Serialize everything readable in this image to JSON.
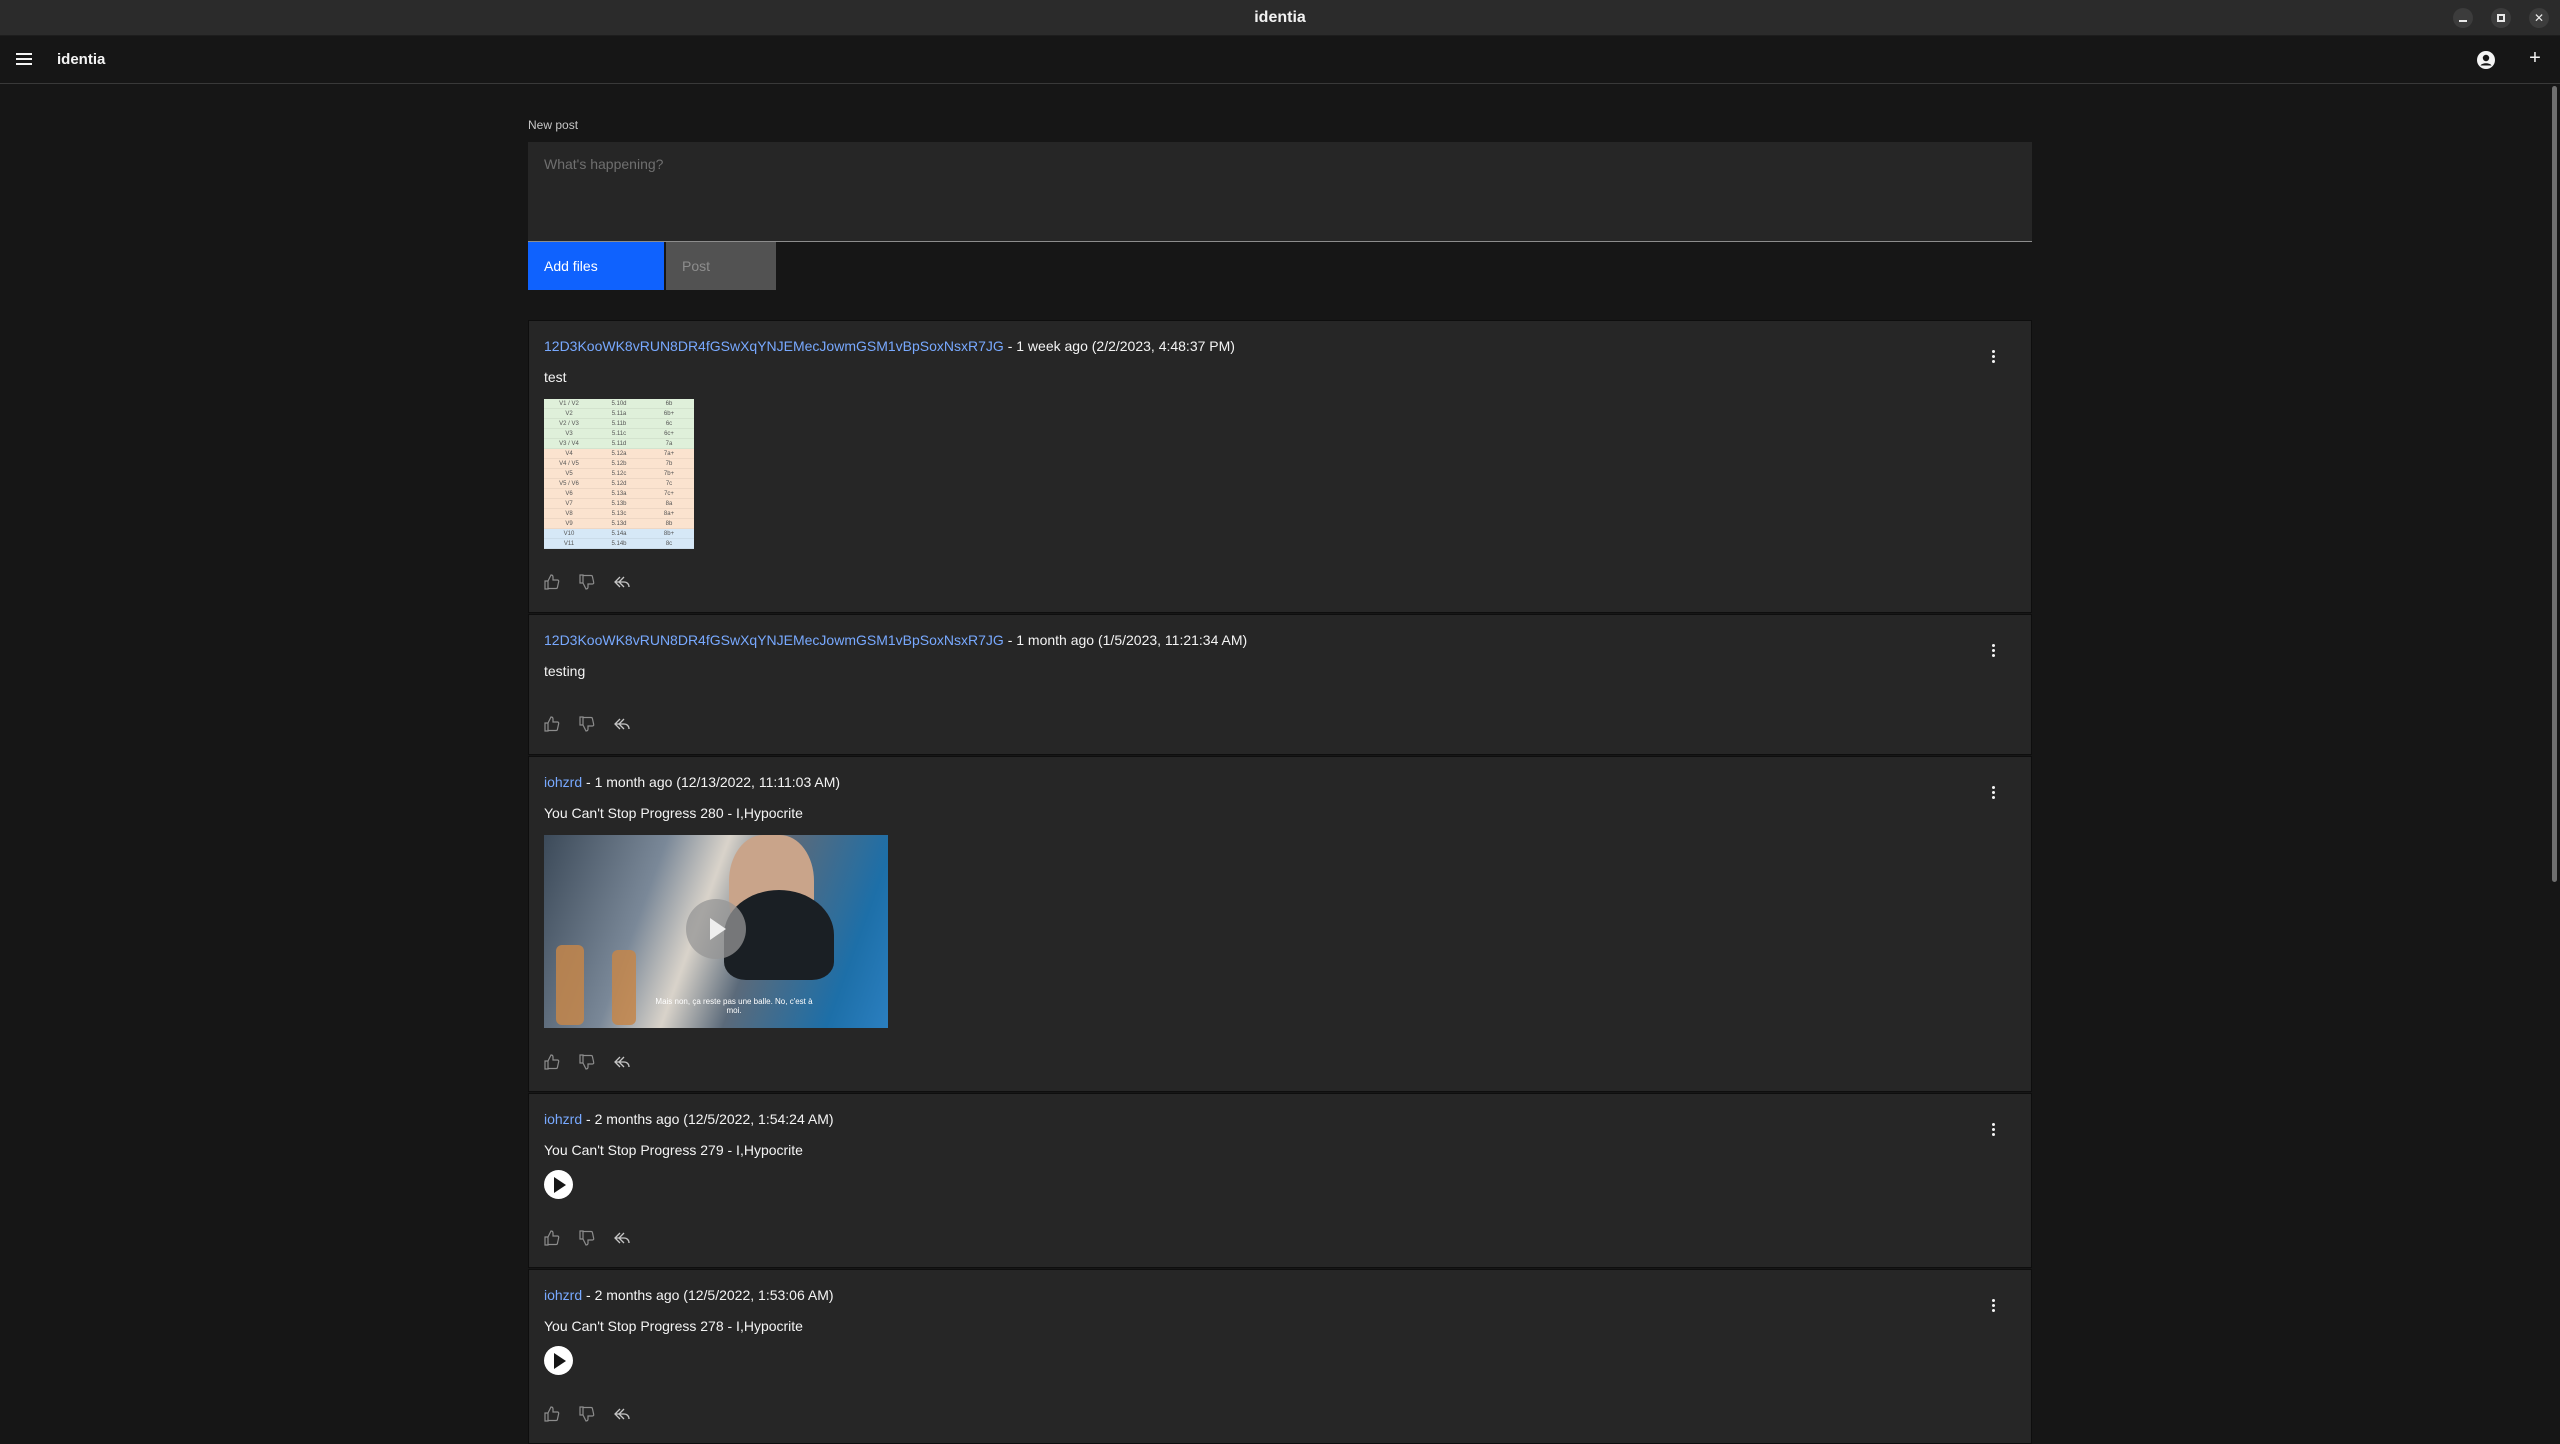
{
  "window": {
    "title": "identia"
  },
  "appbar": {
    "brand": "identia"
  },
  "composer": {
    "label": "New post",
    "placeholder": "What's happening?",
    "add_files_label": "Add files",
    "post_label": "Post"
  },
  "posts": [
    {
      "author": "12D3KooWK8vRUN8DR4fGSwXqYNJEMecJowmGSM1vBpSoxNsxR7JG",
      "meta": " - 1 week ago (2/2/2023, 4:48:37 PM)",
      "text": "test",
      "media": "image-table"
    },
    {
      "author": "12D3KooWK8vRUN8DR4fGSwXqYNJEMecJowmGSM1vBpSoxNsxR7JG",
      "meta": " - 1 month ago (1/5/2023, 11:21:34 AM)",
      "text": "testing",
      "media": "none"
    },
    {
      "author": "iohzrd",
      "meta": " - 1 month ago (12/13/2022, 11:11:03 AM)",
      "text": "You Can't Stop Progress 280 - I,Hypocrite",
      "media": "video",
      "video_subtitle": "Mais non, ça reste pas une balle. No, c'est à moi."
    },
    {
      "author": "iohzrd",
      "meta": " - 2 months ago (12/5/2022, 1:54:24 AM)",
      "text": "You Can't Stop Progress 279 - I,Hypocrite",
      "media": "audio"
    },
    {
      "author": "iohzrd",
      "meta": " - 2 months ago (12/5/2022, 1:53:06 AM)",
      "text": "You Can't Stop Progress 278 - I,Hypocrite",
      "media": "audio"
    }
  ],
  "table_thumb_rows": [
    [
      "V1 / V2",
      "5.10d",
      "6b"
    ],
    [
      "V2",
      "5.11a",
      "6b+"
    ],
    [
      "V2 / V3",
      "5.11b",
      "6c"
    ],
    [
      "V3",
      "5.11c",
      "6c+"
    ],
    [
      "V3 / V4",
      "5.11d",
      "7a"
    ],
    [
      "V4",
      "5.12a",
      "7a+"
    ],
    [
      "V4 / V5",
      "5.12b",
      "7b"
    ],
    [
      "V5",
      "5.12c",
      "7b+"
    ],
    [
      "V5 / V6",
      "5.12d",
      "7c"
    ],
    [
      "V6",
      "5.13a",
      "7c+"
    ],
    [
      "V7",
      "5.13b",
      "8a"
    ],
    [
      "V8",
      "5.13c",
      "8a+"
    ],
    [
      "V9",
      "5.13d",
      "8b"
    ],
    [
      "V10",
      "5.14a",
      "8b+"
    ],
    [
      "V11",
      "5.14b",
      "8c"
    ]
  ]
}
